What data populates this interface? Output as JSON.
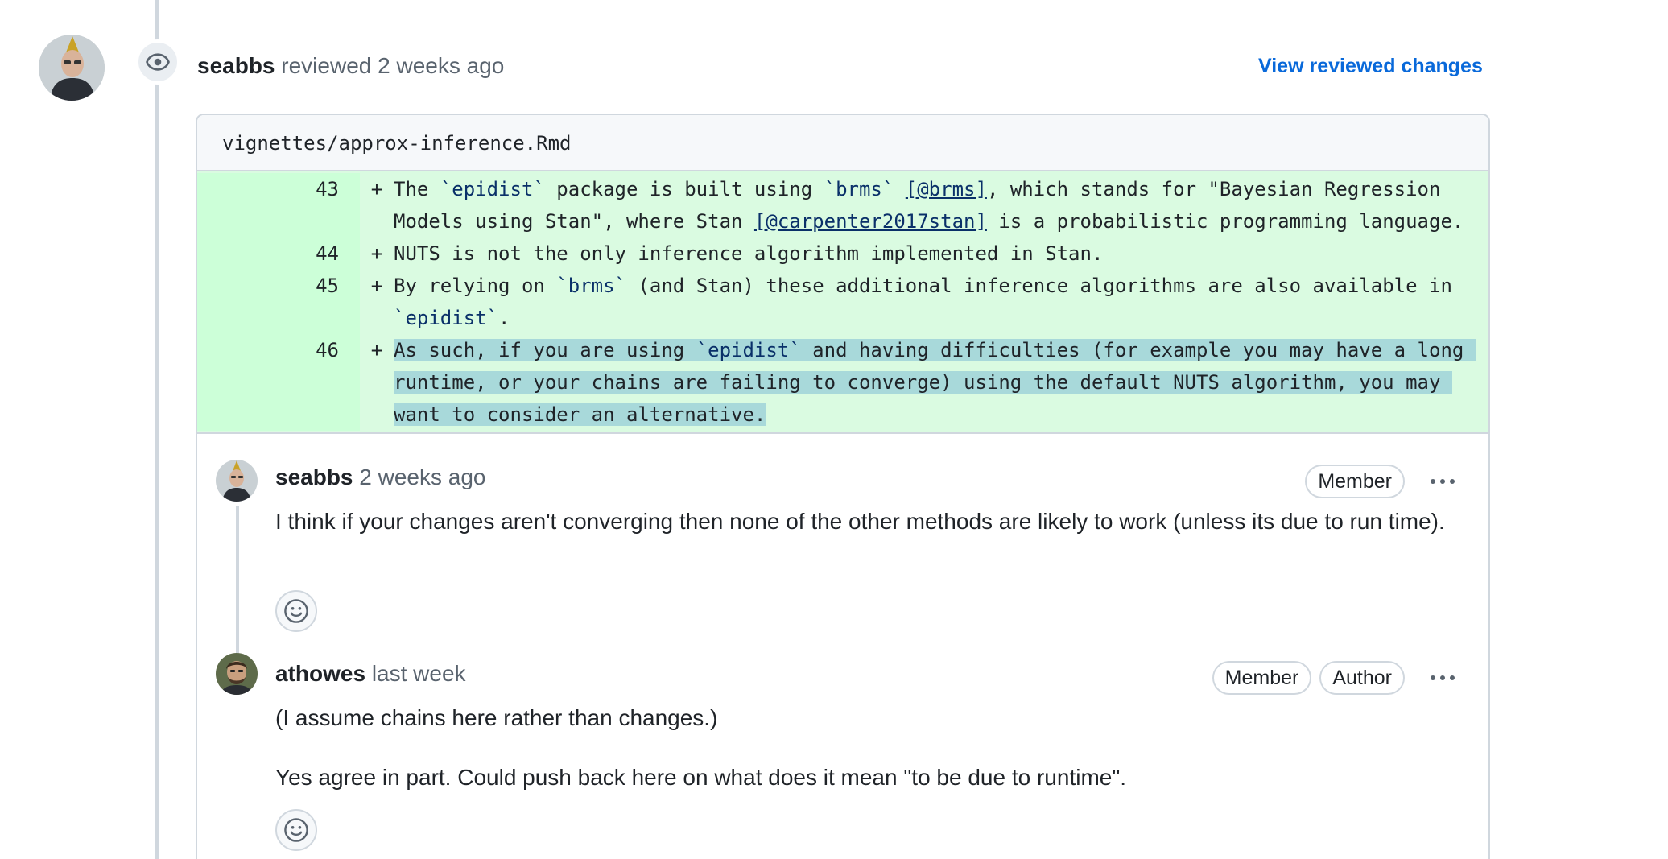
{
  "review": {
    "author": "seabbs",
    "action": "reviewed",
    "time": "2 weeks ago",
    "view_changes_label": "View reviewed changes",
    "avatar_icon": "user-avatar",
    "event_icon": "eye-icon"
  },
  "file": {
    "path": "vignettes/approx-inference.Rmd"
  },
  "diff_lines": [
    {
      "number": "43",
      "marker": "+",
      "segments": [
        "The ",
        "`epidist`",
        " package is built using ",
        "`brms`",
        " ",
        "[@brms]",
        ", which stands for \"Bayesian Regression Models using Stan\", where Stan ",
        "[@carpenter2017stan]",
        " is a probabilistic programming language."
      ]
    },
    {
      "number": "44",
      "marker": "+",
      "segments": [
        "NUTS is not the only inference algorithm implemented in Stan."
      ]
    },
    {
      "number": "45",
      "marker": "+",
      "segments": [
        "By relying on ",
        "`brms`",
        " (and Stan) these additional inference algorithms are also available in ",
        "`epidist`",
        "."
      ]
    },
    {
      "number": "46",
      "marker": "+",
      "segments": [
        "As such, if you are using ",
        "`epidist`",
        " and having difficulties (for example you may have a long runtime, or your chains are failing to converge) using the default NUTS algorithm, you may want to consider an alternative."
      ]
    }
  ],
  "comments": [
    {
      "author": "seabbs",
      "time": "2 weeks ago",
      "badges": [
        "Member"
      ],
      "paragraphs": [
        "I think if your changes aren't converging then none of the other methods are likely to work (unless its due to run time)."
      ],
      "reaction_icon": "smiley-icon",
      "menu_icon": "kebab-horizontal-icon"
    },
    {
      "author": "athowes",
      "time": "last week",
      "badges": [
        "Member",
        "Author"
      ],
      "paragraphs": [
        "(I assume chains here rather than changes.)",
        "Yes agree in part. Could push back here on what does it mean \"to be due to runtime\"."
      ],
      "reaction_icon": "smiley-icon",
      "menu_icon": "kebab-horizontal-icon"
    }
  ],
  "colors": {
    "accent_link": "#0969da",
    "diff_added_bg": "#dafbe1",
    "diff_added_gutter": "#ccffd8",
    "selection_highlight": "#a8d9da",
    "border": "#d0d7de"
  }
}
